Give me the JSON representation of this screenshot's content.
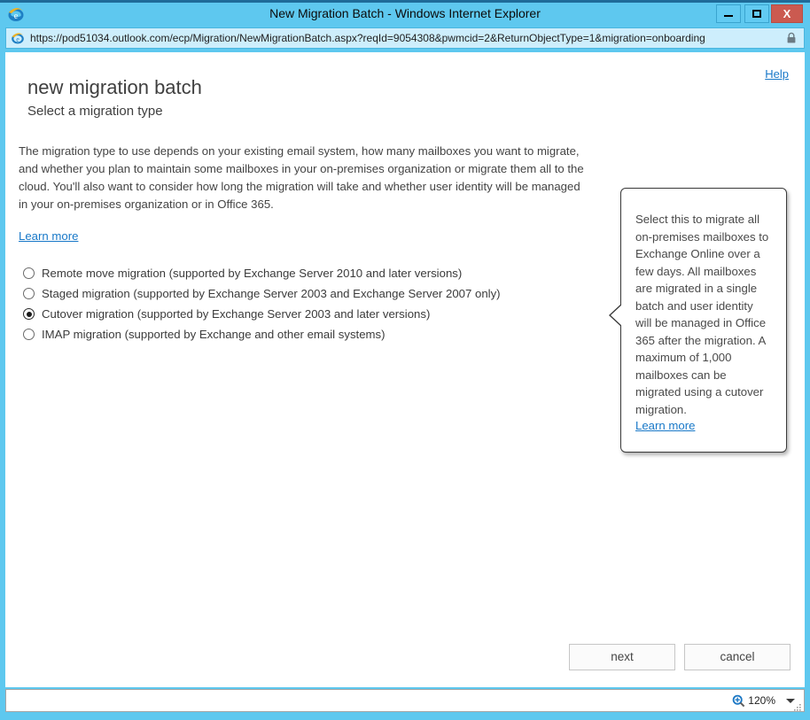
{
  "window": {
    "title": "New Migration Batch - Windows Internet Explorer",
    "minimize_label": "Minimize",
    "maximize_label": "Maximize",
    "close_label": "X"
  },
  "address_bar": {
    "url_scheme": "https://",
    "url_rest": "pod51034.outlook.com/ecp/Migration/NewMigrationBatch.aspx?reqId=9054308&pwmcid=2&ReturnObjectType=1&migration=onboarding",
    "url_full": "https://pod51034.outlook.com/ecp/Migration/NewMigrationBatch.aspx?reqId=9054308&pwmcid=2&ReturnObjectType=1&migration=onboarding",
    "security_icon": "lock-icon"
  },
  "page": {
    "help_label": "Help",
    "title": "new migration batch",
    "subtitle": "Select a migration type",
    "intro_paragraph": "The migration type to use depends on your existing email system, how many mailboxes you want to migrate, and whether you plan to maintain some mailboxes in your on-premises organization or migrate them all to the cloud. You'll also want to consider how long the migration will take and whether user identity will be managed in your on-premises organization or in Office 365.",
    "learn_more_label": "Learn more"
  },
  "options": [
    {
      "id": "remote-move",
      "label": "Remote move migration (supported by Exchange Server 2010 and later versions)",
      "selected": false
    },
    {
      "id": "staged",
      "label": "Staged migration (supported by Exchange Server 2003 and Exchange Server 2007 only)",
      "selected": false
    },
    {
      "id": "cutover",
      "label": "Cutover migration (supported by Exchange Server 2003 and later versions)",
      "selected": true
    },
    {
      "id": "imap",
      "label": "IMAP migration (supported by Exchange and other email systems)",
      "selected": false
    }
  ],
  "callout": {
    "text": "Select this to migrate all on-premises mailboxes to Exchange Online over a few days. All mailboxes are migrated in a single batch and user identity will be managed in Office 365 after the migration. A maximum of 1,000 mailboxes can be migrated using a cutover migration.",
    "learn_more_label": "Learn more"
  },
  "footer": {
    "next_label": "next",
    "cancel_label": "cancel"
  },
  "statusbar": {
    "zoom_level": "120%",
    "zoom_icon": "magnifier-icon"
  },
  "colors": {
    "window_chrome": "#5ec8ef",
    "top_strip": "#1f6b99",
    "close_button": "#cb5a50",
    "link": "#1878c8",
    "address_field": "#cdeefc",
    "text": "#3f3f3f"
  }
}
